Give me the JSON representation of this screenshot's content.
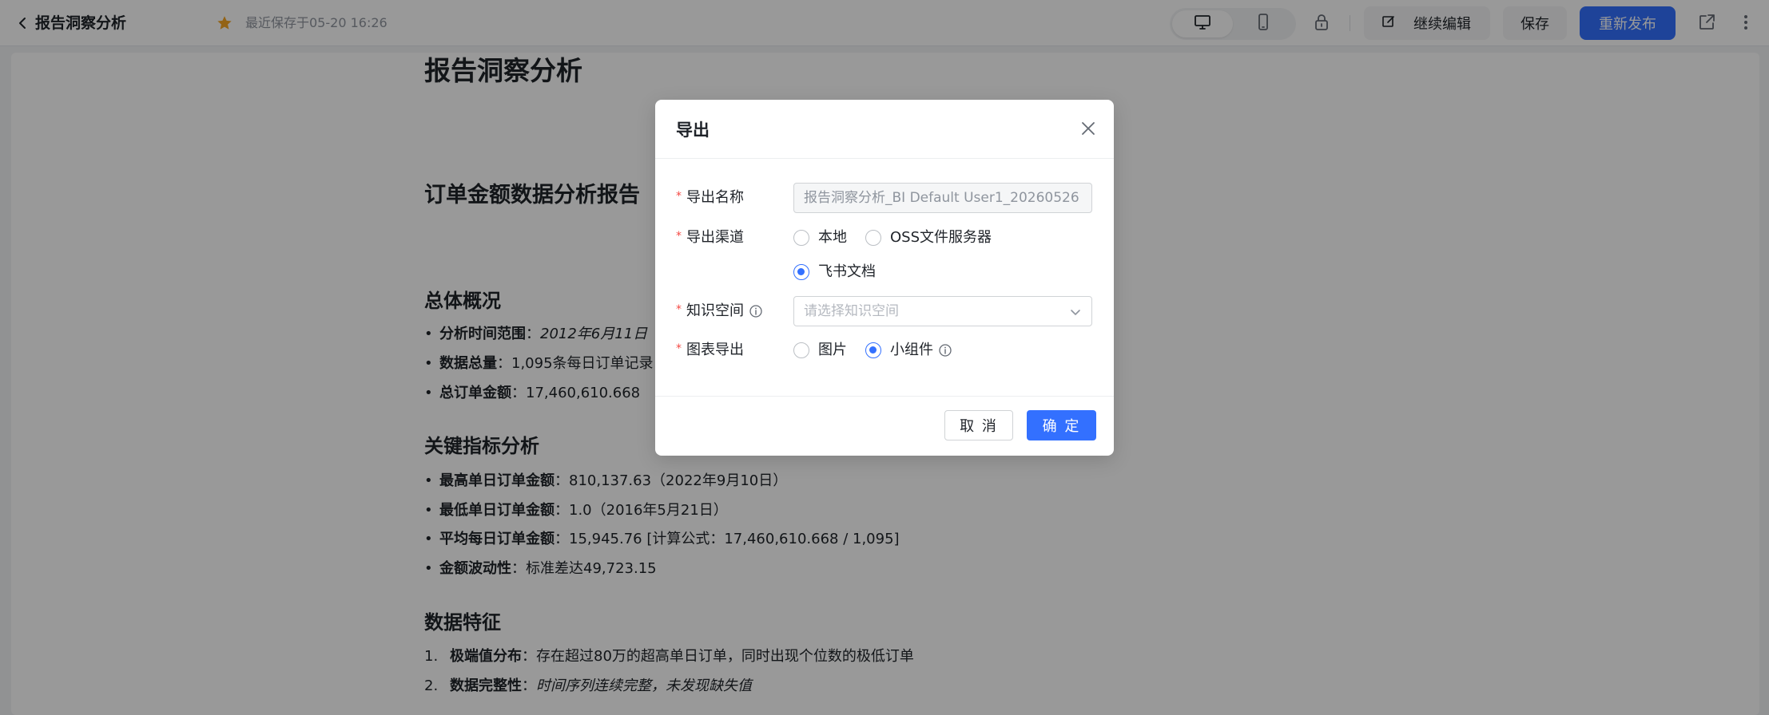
{
  "header": {
    "title": "报告洞察分析",
    "last_saved": "最近保存于05-20 16:26",
    "continue_edit_label": "继续编辑",
    "save_label": "保存",
    "republish_label": "重新发布"
  },
  "doc": {
    "title": "报告洞察分析",
    "report_title": "订单金额数据分析报告",
    "sections": [
      {
        "heading": "总体概况",
        "items": [
          {
            "label": "分析时间范围",
            "sep": "：",
            "value": "2012年6月11日"
          },
          {
            "label": "数据总量",
            "sep": "：",
            "value": "1,095条每日订单记录"
          },
          {
            "label": "总订单金额",
            "sep": "：",
            "value": "17,460,610.668"
          }
        ]
      },
      {
        "heading": "关键指标分析",
        "items": [
          {
            "label": "最高单日订单金额",
            "sep": "：",
            "value": "810,137.63（2022年9月10日）"
          },
          {
            "label": "最低单日订单金额",
            "sep": "：",
            "value": "1.0（2016年5月21日）"
          },
          {
            "label": "平均每日订单金额",
            "sep": "：",
            "value": "15,945.76 [计算公式：17,460,610.668 / 1,095]"
          },
          {
            "label": "金额波动性",
            "sep": "：",
            "value": "标准差达49,723.15"
          }
        ]
      },
      {
        "heading": "数据特征",
        "items": [
          {
            "num": "1.",
            "label": "极端值分布",
            "sep": "：",
            "value": "存在超过80万的超高单日订单，同时出现个位数的极低订单"
          },
          {
            "num": "2.",
            "label": "数据完整性",
            "sep": "：",
            "value": "时间序列连续完整，未发现缺失值"
          }
        ]
      }
    ]
  },
  "modal": {
    "title": "导出",
    "fields": {
      "name_label": "导出名称",
      "name_value": "报告洞察分析_BI Default User1_20260526",
      "channel_label": "导出渠道",
      "channel_options": [
        "本地",
        "OSS文件服务器",
        "飞书文档"
      ],
      "channel_selected": "飞书文档",
      "space_label": "知识空间",
      "space_placeholder": "请选择知识空间",
      "chart_label": "图表导出",
      "chart_options": [
        "图片",
        "小组件"
      ],
      "chart_selected": "小组件"
    },
    "cancel_label": "取 消",
    "ok_label": "确 定"
  },
  "icons": {
    "back": "chevron-left-icon",
    "favorite": "star-icon",
    "desktop": "desktop-icon",
    "mobile": "mobile-icon",
    "lock": "lock-icon",
    "edit": "edit-icon",
    "share": "share-icon",
    "more": "more-vertical-icon",
    "close": "close-icon",
    "info": "info-icon",
    "dropdown": "chevron-down-icon"
  },
  "colors": {
    "primary": "#3370ff",
    "required": "#f54a45",
    "star": "#f5a623",
    "overlay": "rgba(0,0,0,0.40)"
  }
}
